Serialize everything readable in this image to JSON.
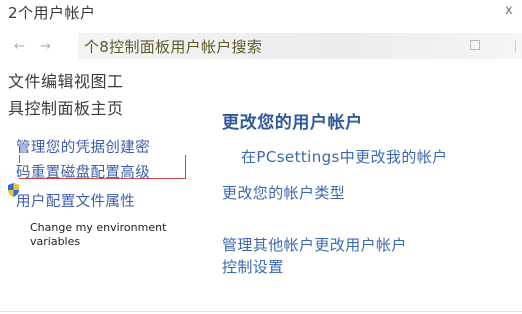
{
  "window": {
    "title": "2个用户帐户",
    "close_glyph": "x"
  },
  "nav": {
    "back_glyph": "←",
    "forward_glyph": "→",
    "address": "个8控制面板用户帐户搜索"
  },
  "menubar": {
    "line1": "文件编辑视图工",
    "line2": "具控制面板主页"
  },
  "sidebar": {
    "link1": "管理您的凭据创建密",
    "link2": "码重置磁盘配置高级",
    "link3": "用户配置文件属性",
    "env_text": "Change my environment variables",
    "shield_icon": "uac-shield-icon"
  },
  "main": {
    "heading": "更改您的用户帐户",
    "pc_settings_link": "在PCsettings中更改我的帐户",
    "change_type_link": "更改您的帐户类型",
    "manage_other_line1": "管理其他帐户更改用户帐户",
    "manage_other_line2": "控制设置"
  },
  "colors": {
    "link": "#3a68b5",
    "heading": "#2f5a9c",
    "highlight_border": "#c44848"
  }
}
